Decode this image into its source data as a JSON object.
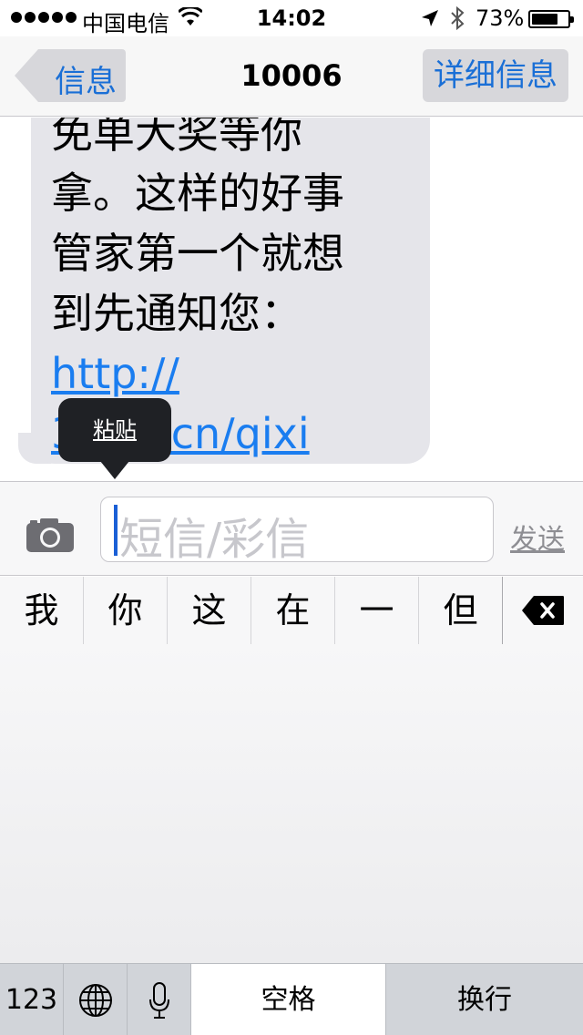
{
  "status_bar": {
    "carrier": "中国电信",
    "time": "14:02",
    "battery_percent": "73%",
    "battery_level": 0.73,
    "icons": [
      "signal-dots-icon",
      "wifi-icon",
      "location-arrow-icon",
      "bluetooth-icon",
      "battery-icon"
    ]
  },
  "nav": {
    "back_label": "信息",
    "title": "10006",
    "detail_label": "详细信息"
  },
  "message": {
    "lines": [
      "免单大奖等你",
      "拿。这样的好事",
      "管家第一个就想",
      "到先通知您："
    ],
    "link_lines": [
      "http://",
      "3189.cn/qixi"
    ]
  },
  "tooltip": {
    "label": "粘贴"
  },
  "compose": {
    "placeholder": "短信/彩信",
    "send_label": "发送",
    "camera_icon": "camera-icon"
  },
  "candidates": [
    "我",
    "你",
    "这",
    "在",
    "一",
    "但"
  ],
  "keyboard": {
    "numbers_label": "123",
    "space_label": "空格",
    "return_label": "换行",
    "icons": [
      "globe-icon",
      "microphone-icon",
      "delete-key-icon"
    ]
  },
  "colors": {
    "accent": "#1a6fd6",
    "link": "#1a7df0",
    "bubble": "#e5e5ea"
  }
}
